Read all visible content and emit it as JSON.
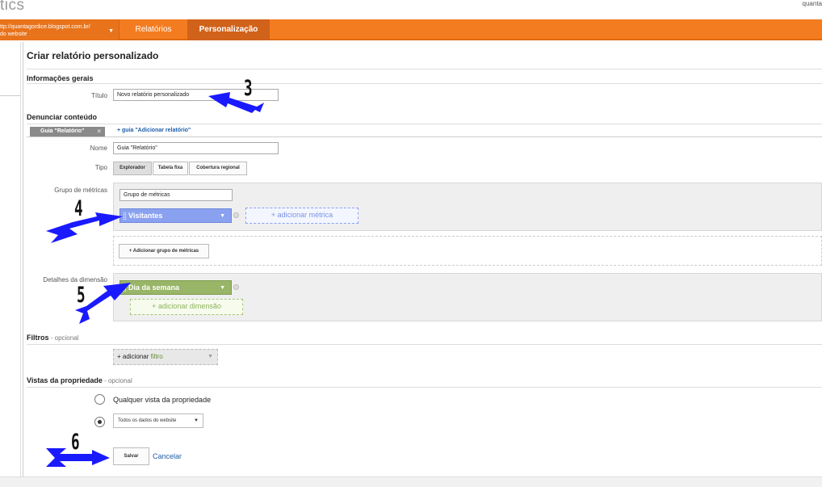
{
  "header": {
    "logo_fragment": "tics",
    "user_fragment": "quanta",
    "property_url": "ttp://quantagordice.blogspot.com.br/",
    "property_view": "do website",
    "tabs": [
      "Relatórios",
      "Personalização"
    ]
  },
  "page": {
    "title": "Criar relatório personalizado"
  },
  "general_info": {
    "heading": "Informações gerais",
    "title_label": "Título",
    "title_value": "Novo relatório personalizado"
  },
  "report_content": {
    "heading": "Denunciar conteúdo",
    "guide_tab": "Guia \"Relatório\"",
    "guide_tab_close": "×",
    "add_guide": "+ guia \"Adicionar relatório\"",
    "name_label": "Nome",
    "name_value": "Guia \"Relatório\"",
    "type_label": "Tipo",
    "types": [
      "Explorador",
      "Tabela fixa",
      "Cobertura regional"
    ],
    "selected_type": "Explorador",
    "metric_group_label": "Grupo de métricas",
    "metric_group_value": "Grupo de métricas",
    "metric": "Visitantes",
    "add_metric": "+ adicionar métrica",
    "add_metric_group": "+ Adicionar grupo de métricas",
    "dimension_label": "Detalhes da dimensão",
    "dimension": "Dia da semana",
    "add_dimension": "+ adicionar dimensão"
  },
  "filters": {
    "heading": "Filtros",
    "optional": " - opcional",
    "add_prefix": "+ adicionar ",
    "add_word": "filtro"
  },
  "property_views": {
    "heading": "Vistas da propriedade",
    "optional": " - opcional",
    "option_any": "Qualquer vista da propriedade",
    "option_selected": "Todos os dados do website",
    "selected_index": 1
  },
  "actions": {
    "save": "Salvar",
    "cancel": "Cancelar"
  },
  "annotations": [
    "3",
    "4",
    "5",
    "6"
  ],
  "colors": {
    "nav_orange": "#f47c20",
    "metric_blue": "#8aa1f0",
    "dimension_green": "#99b567",
    "annotation_arrow": "#1a1aff",
    "link_blue": "#1f5ea8"
  }
}
